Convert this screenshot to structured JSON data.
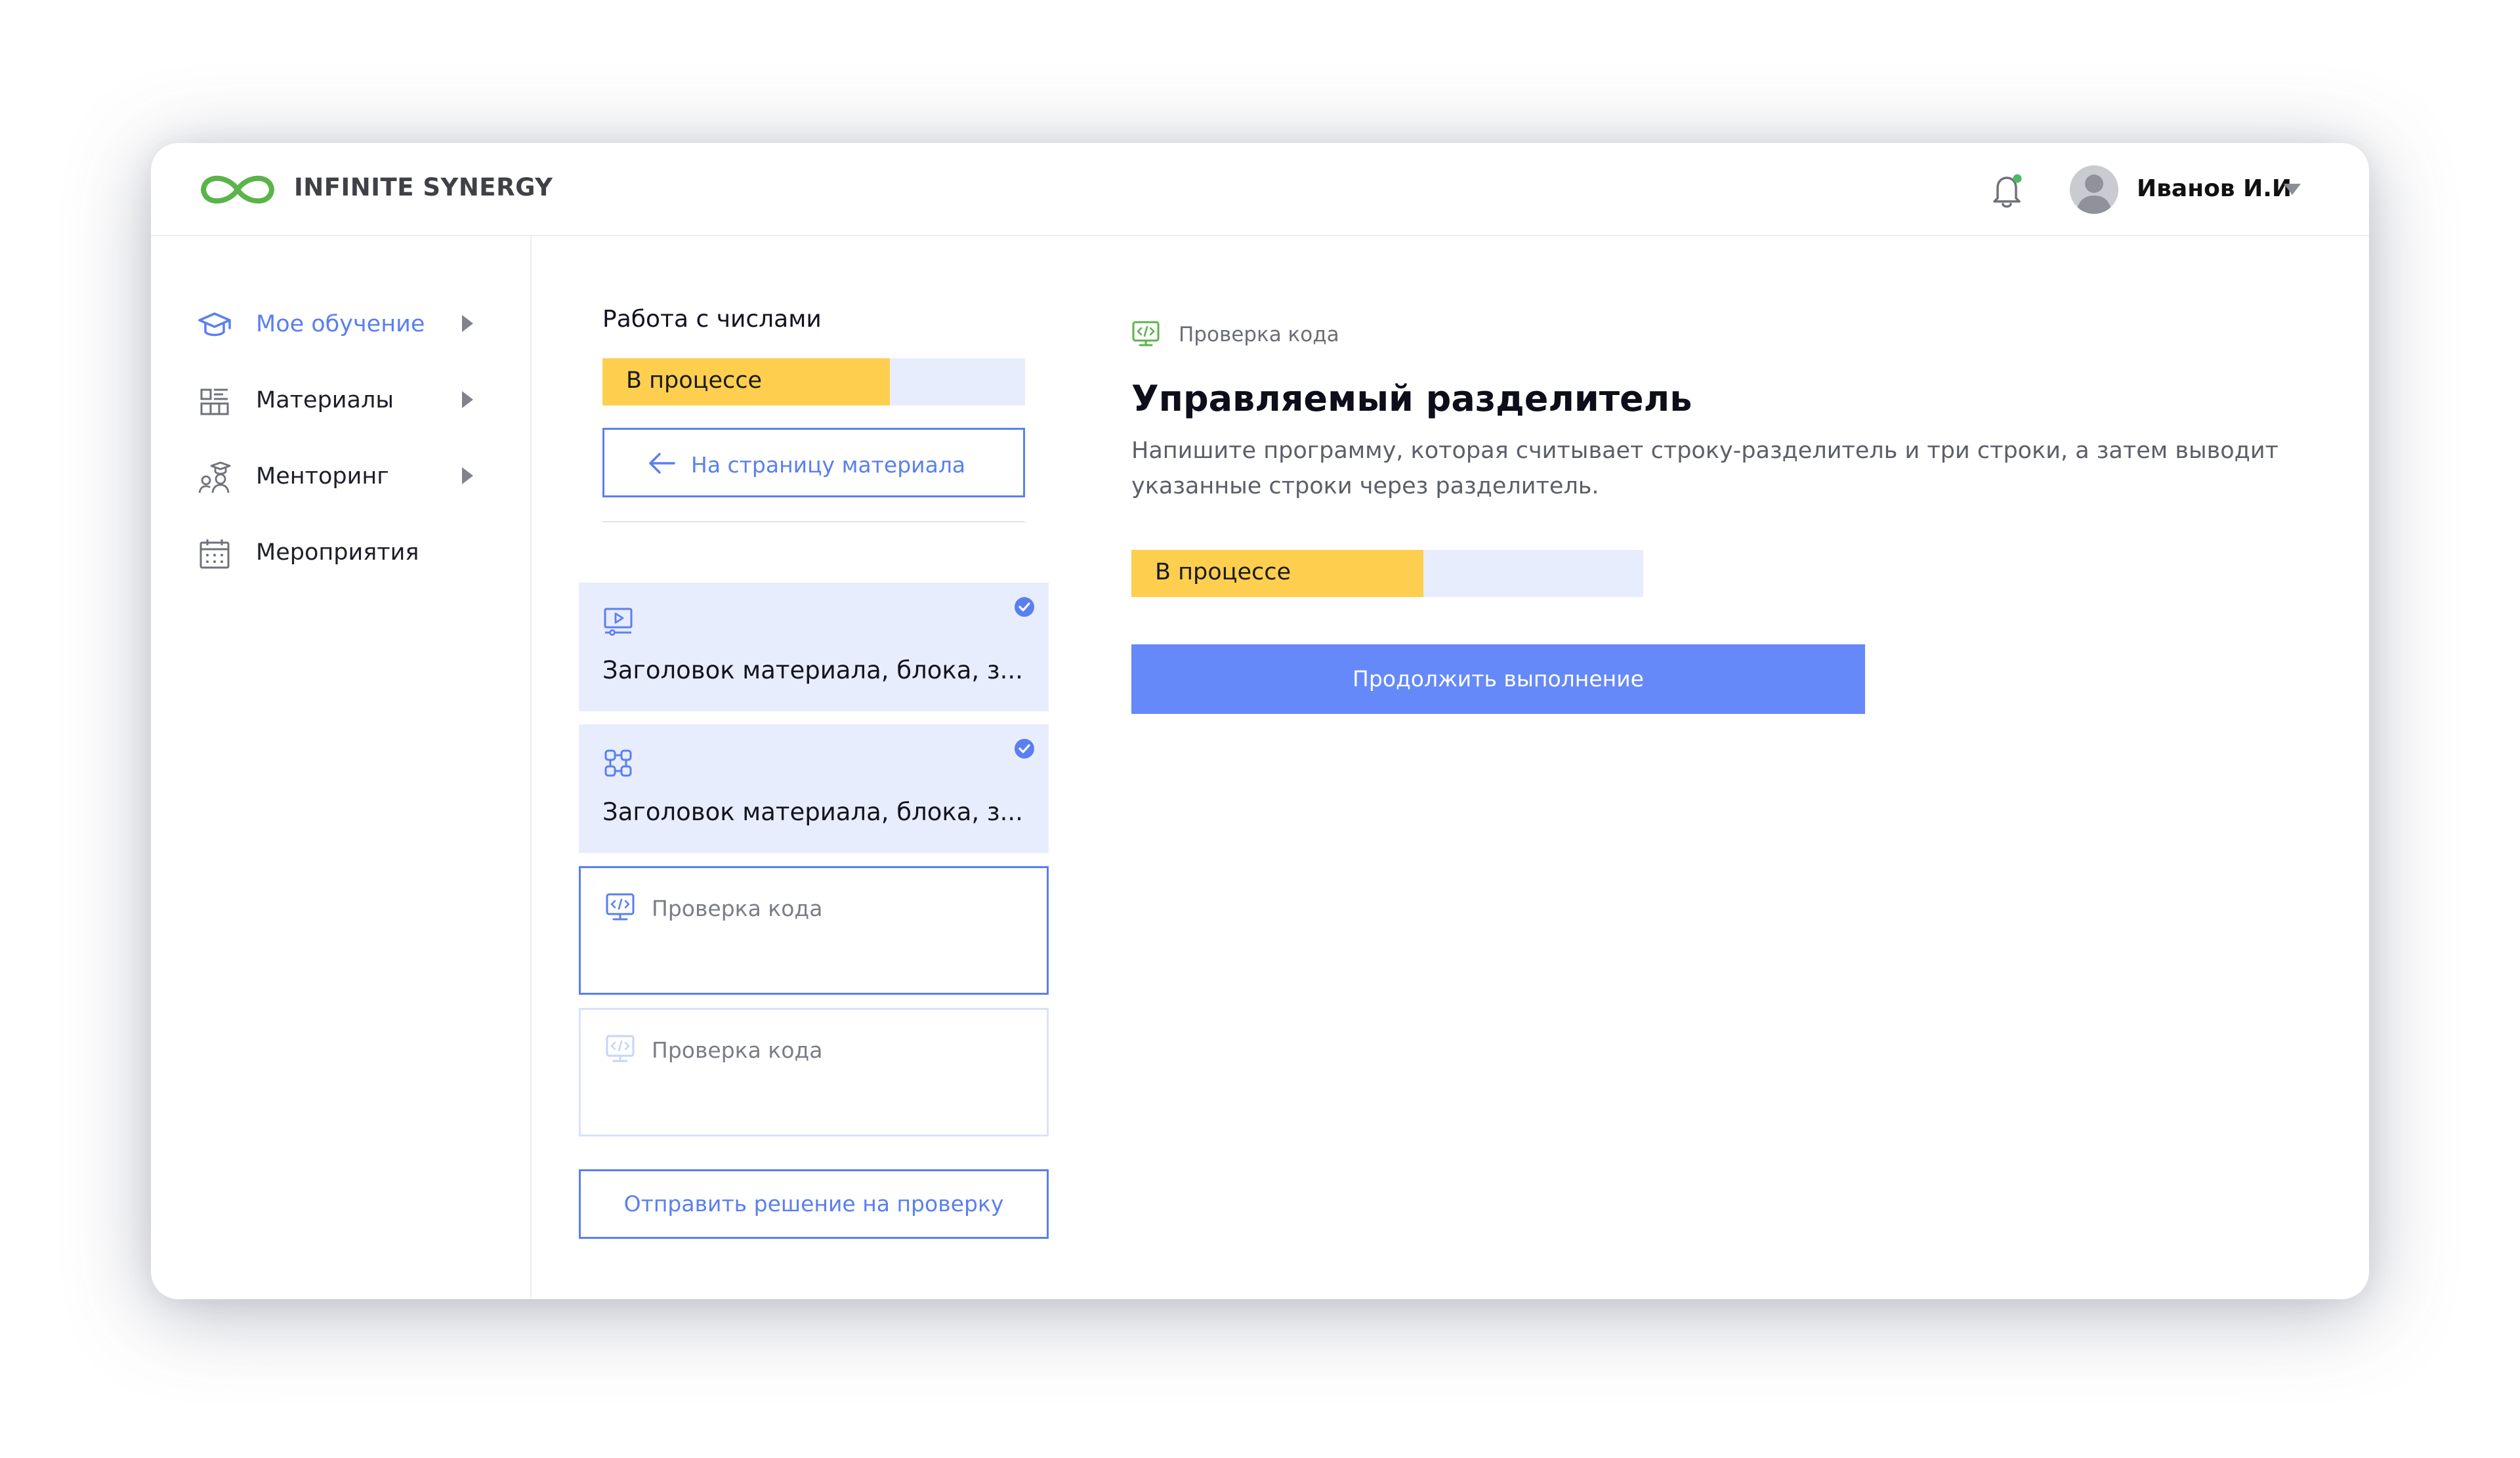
{
  "header": {
    "brand": "INFINITE SYNERGY",
    "user_name": "Иванов И.И",
    "colors": {
      "brand_green": "#5ab44a",
      "notification_dot": "#4cb963"
    }
  },
  "sidebar": {
    "items": [
      {
        "label": "Мое обучение",
        "icon": "graduation-cap-icon",
        "active": true,
        "has_submenu": true
      },
      {
        "label": "Материалы",
        "icon": "materials-icon",
        "active": false,
        "has_submenu": true
      },
      {
        "label": "Менторинг",
        "icon": "mentoring-icon",
        "active": false,
        "has_submenu": true
      },
      {
        "label": "Мероприятия",
        "icon": "calendar-icon",
        "active": false,
        "has_submenu": false
      }
    ]
  },
  "course": {
    "title": "Работа с числами",
    "status": "В процессе",
    "progress": 0.68,
    "back_label": "На страницу материала"
  },
  "materials": [
    {
      "title": "Заголовок материала, блока, з...",
      "icon": "video-lesson-icon",
      "state": "done"
    },
    {
      "title": "Заголовок материала, блока, з...",
      "icon": "modules-icon",
      "state": "done"
    },
    {
      "title": "Проверка кода",
      "icon": "code-check-icon",
      "state": "current"
    },
    {
      "title": "Проверка кода",
      "icon": "code-check-icon",
      "state": "locked"
    }
  ],
  "submit_label": "Отправить решение на проверку",
  "task": {
    "category": "Проверка кода",
    "title": "Управляемый разделитель",
    "description": "Напишите программу, которая считывает строку-разделитель и три строки, а затем выводит указанные строки через разделитель.",
    "status": "В процессе",
    "progress": 0.57,
    "continue_label": "Продолжить выполнение"
  },
  "colors": {
    "accent": "#5a7ff0",
    "button_fill": "#6589f8",
    "progress_fill": "#fecf4f",
    "progress_track": "#e8edfd",
    "card_done_bg": "#e8edfd"
  }
}
